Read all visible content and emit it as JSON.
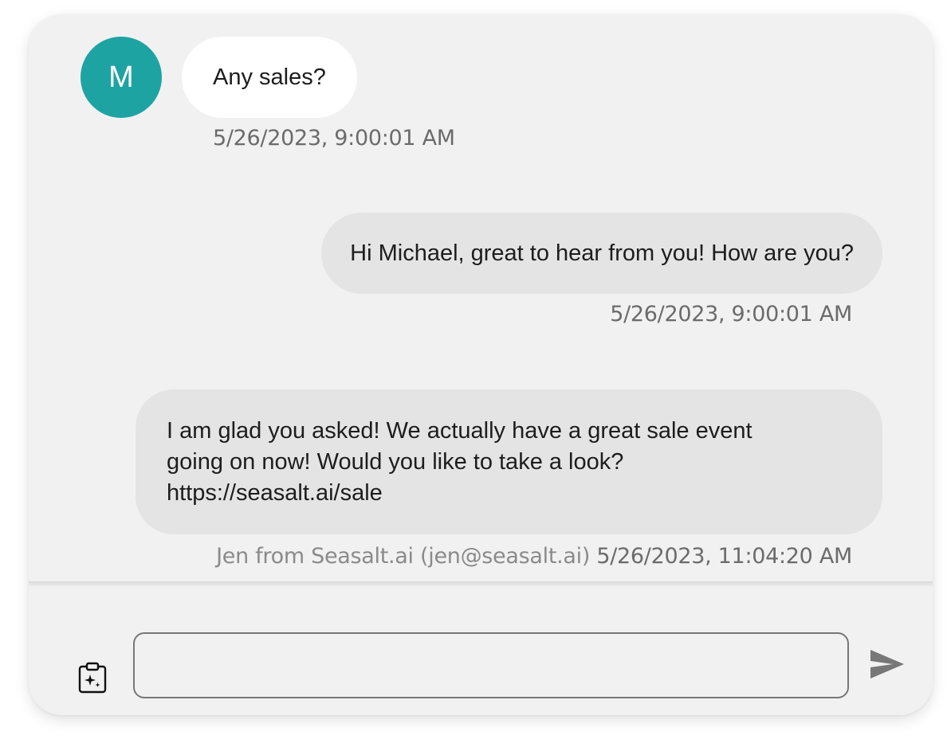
{
  "contact": {
    "avatar_initial": "M",
    "avatar_color": "#1ea3a3"
  },
  "messages": [
    {
      "direction": "incoming",
      "text": "Any sales?",
      "timestamp": "5/26/2023, 9:00:01 AM"
    },
    {
      "direction": "outgoing",
      "text": "Hi Michael, great to hear from you! How are you?",
      "timestamp": "5/26/2023, 9:00:01 AM"
    },
    {
      "direction": "outgoing",
      "text_lines": [
        "I am glad you asked! We actually have a great sale event",
        "going on now! Would you like to take a look?",
        "https://seasalt.ai/sale"
      ],
      "sender": "Jen from Seasalt.ai (jen@seasalt.ai)",
      "timestamp": "5/26/2023, 11:04:20 AM"
    }
  ],
  "composer": {
    "input_value": "",
    "placeholder": "",
    "ai_icon": "ai-assist-clipboard-sparkle-icon",
    "send_icon": "send-icon"
  },
  "colors": {
    "card_background": "#f1f1f1",
    "incoming_bubble": "#ffffff",
    "outgoing_bubble": "#e4e4e4",
    "send_icon": "#777777"
  }
}
